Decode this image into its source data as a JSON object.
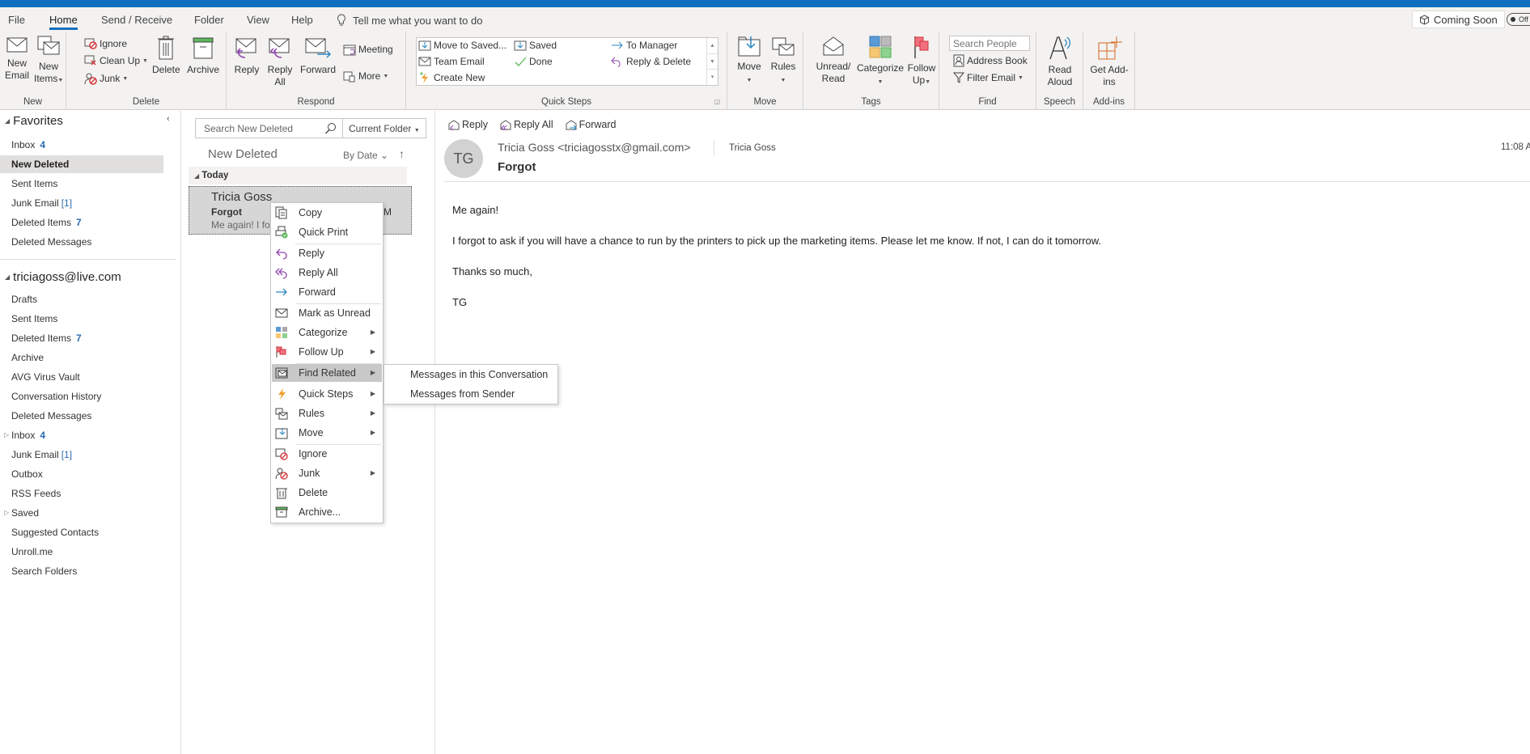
{
  "menubar": {
    "tabs": [
      {
        "label": "File",
        "active": false
      },
      {
        "label": "Home",
        "active": true
      },
      {
        "label": "Send / Receive",
        "active": false
      },
      {
        "label": "Folder",
        "active": false
      },
      {
        "label": "View",
        "active": false
      },
      {
        "label": "Help",
        "active": false
      }
    ],
    "tell_me": "Tell me what you want to do",
    "coming_soon": "Coming Soon",
    "toggle_label": "Off"
  },
  "ribbon": {
    "new": {
      "label": "New",
      "new_email": "New Email",
      "new_items": "New Items"
    },
    "delete": {
      "label": "Delete",
      "ignore": "Ignore",
      "clean_up": "Clean Up",
      "junk": "Junk",
      "delete": "Delete",
      "archive": "Archive"
    },
    "respond": {
      "label": "Respond",
      "reply": "Reply",
      "reply_all": "Reply All",
      "forward": "Forward",
      "meeting": "Meeting",
      "more": "More"
    },
    "quick_steps": {
      "label": "Quick Steps",
      "items": [
        "Move to Saved...",
        "Team Email",
        "Create New",
        "Saved",
        "Done",
        "To Manager",
        "Reply & Delete"
      ]
    },
    "move": {
      "label": "Move",
      "move": "Move",
      "rules": "Rules"
    },
    "tags": {
      "label": "Tags",
      "unread_read": "Unread/ Read",
      "categorize": "Categorize",
      "follow_up": "Follow Up"
    },
    "find": {
      "label": "Find",
      "search_people_placeholder": "Search People",
      "address_book": "Address Book",
      "filter_email": "Filter Email"
    },
    "speech": {
      "label": "Speech",
      "read_aloud": "Read Aloud"
    },
    "addins": {
      "label": "Add-ins",
      "get_addins": "Get Add-ins"
    }
  },
  "folder_pane": {
    "favorites_header": "Favorites",
    "favorites": [
      {
        "label": "Inbox",
        "count": "4"
      },
      {
        "label": "New Deleted",
        "count": "",
        "selected": true
      },
      {
        "label": "Sent Items",
        "count": ""
      },
      {
        "label": "Junk Email",
        "count": "[1]"
      },
      {
        "label": "Deleted Items",
        "count": "7"
      },
      {
        "label": "Deleted Messages",
        "count": ""
      }
    ],
    "account_header": "triciagoss@live.com",
    "account_folders": [
      {
        "label": "Drafts",
        "count": ""
      },
      {
        "label": "Sent Items",
        "count": ""
      },
      {
        "label": "Deleted Items",
        "count": "7"
      },
      {
        "label": "Archive",
        "count": ""
      },
      {
        "label": "AVG Virus Vault",
        "count": ""
      },
      {
        "label": "Conversation History",
        "count": ""
      },
      {
        "label": "Deleted Messages",
        "count": ""
      },
      {
        "label": "Inbox",
        "count": "4",
        "expandable": true
      },
      {
        "label": "Junk Email",
        "count": "[1]"
      },
      {
        "label": "Outbox",
        "count": ""
      },
      {
        "label": "RSS Feeds",
        "count": ""
      },
      {
        "label": "Saved",
        "count": "",
        "expandable": true
      },
      {
        "label": "Suggested Contacts",
        "count": ""
      },
      {
        "label": "Unroll.me",
        "count": ""
      },
      {
        "label": "Search Folders",
        "count": ""
      }
    ]
  },
  "message_list": {
    "search_placeholder": "Search New Deleted",
    "scope": "Current Folder",
    "title": "New Deleted",
    "sort": "By Date",
    "group": "Today",
    "messages": [
      {
        "sender": "Tricia Goss",
        "subject": "Forgot",
        "preview": "Me again!  I fo",
        "time": "M"
      }
    ]
  },
  "reading_pane": {
    "actions": [
      "Reply",
      "Reply All",
      "Forward"
    ],
    "avatar_initials": "TG",
    "from": "Tricia Goss <triciagosstx@gmail.com>",
    "to": "Tricia Goss",
    "subject": "Forgot",
    "time": "11:08 A",
    "body": [
      "Me again!",
      "I forgot to ask if you will have a chance to run by the printers to pick up the marketing items. Please let me know. If not, I can do it tomorrow.",
      "Thanks so much,",
      "TG"
    ]
  },
  "context_menu": {
    "items": [
      {
        "label": "Copy"
      },
      {
        "label": "Quick Print"
      },
      {
        "label": "Reply"
      },
      {
        "label": "Reply All"
      },
      {
        "label": "Forward"
      },
      {
        "label": "Mark as Unread"
      },
      {
        "label": "Categorize",
        "submenu": true
      },
      {
        "label": "Follow Up",
        "submenu": true
      },
      {
        "label": "Find Related",
        "submenu": true,
        "highlighted": true
      },
      {
        "label": "Quick Steps",
        "submenu": true
      },
      {
        "label": "Rules",
        "submenu": true
      },
      {
        "label": "Move",
        "submenu": true
      },
      {
        "label": "Ignore"
      },
      {
        "label": "Junk",
        "submenu": true
      },
      {
        "label": "Delete"
      },
      {
        "label": "Archive..."
      }
    ],
    "submenu_find_related": [
      "Messages in this Conversation",
      "Messages from Sender"
    ]
  }
}
